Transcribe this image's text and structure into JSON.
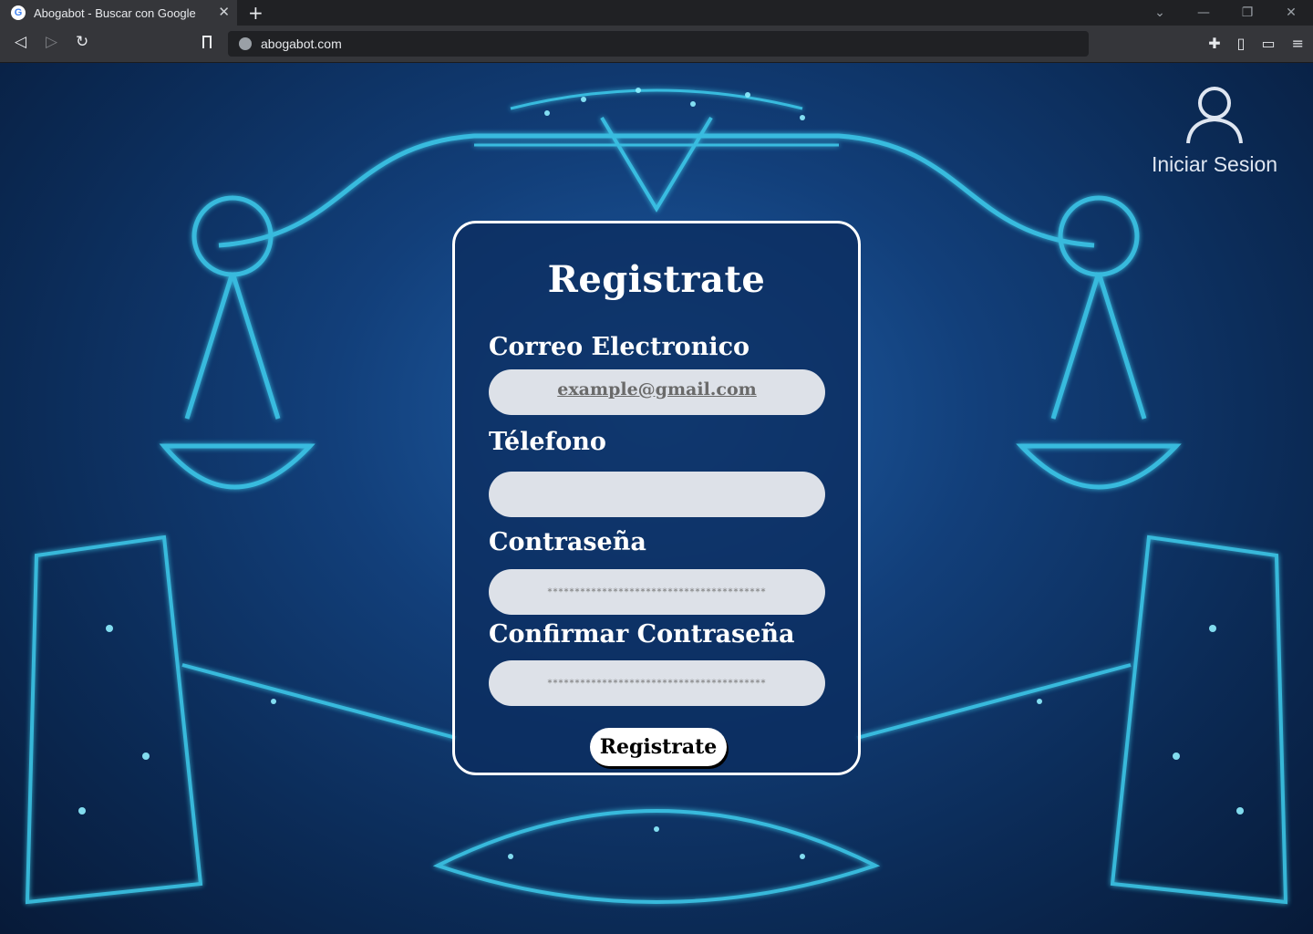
{
  "browser": {
    "tab_title": "Abogabot - Buscar con Google",
    "tab_close": "✕",
    "new_tab": "+",
    "url": "abogabot.com",
    "window_controls": [
      "⌄",
      "—",
      "❐",
      "✕"
    ]
  },
  "header": {
    "login_label": "Iniciar Sesion"
  },
  "form": {
    "title": "Registrate",
    "email_label": "Correo Electronico",
    "email_value": "example@gmail.com",
    "phone_label": "Télefono",
    "phone_value": "",
    "password_label": "Contraseña",
    "password_value": "****************************************",
    "confirm_label": "Confirmar Contraseña",
    "confirm_value": "****************************************",
    "submit_label": "Registrate"
  },
  "colors": {
    "card_border": "#ffffff",
    "input_bg": "#dde1e8",
    "background": "#0b2a55",
    "accent_glow": "#3fd2f2"
  }
}
